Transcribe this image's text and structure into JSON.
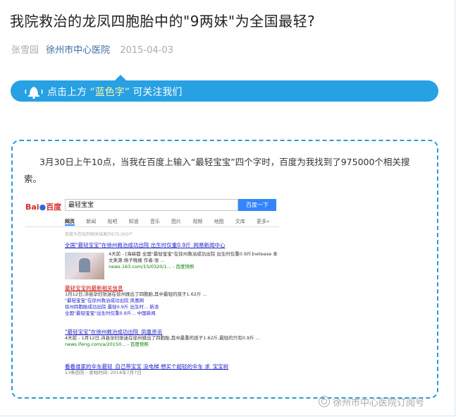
{
  "article": {
    "title": "我院救治的龙凤四胞胎中的\"9两妹\"为全国最轻?",
    "author": "张雪园",
    "account": "徐州市中心医院",
    "date": "2015-04-03"
  },
  "banner": {
    "prefix": "点击上方",
    "highlight": "“蓝色字”",
    "suffix": "可关注我们",
    "color": "#27a0e4"
  },
  "content": {
    "paragraph": "3月30日上午10点，当我在百度上输入“最轻宝宝”四个字时，百度为我找到了975000个相关搜索。",
    "border_color": "#2a9bd6"
  },
  "search_screenshot": {
    "logo": "Bai百度",
    "query": "最轻宝宝",
    "button": "百度一下",
    "tabs": [
      "网页",
      "新闻",
      "贴吧",
      "知道",
      "音乐",
      "图片",
      "视频",
      "地图",
      "文库",
      "更多»"
    ],
    "result_count": "百度为您找到相关结果约975,000个",
    "results": [
      {
        "title": "全国\"最轻宝宝\"在徐州救治成功出院 出生时仅重0.9斤_网易新闻中心",
        "snippet": "4天前 - [海峡都 全国\"最轻宝宝\"在徐州救治成功出院 出生时仅重0.9斤]netease 本文来源:扬子晚报 作者:张 ...",
        "url": "news.163.com/15/0320/1... - 百度快照",
        "related": []
      },
      {
        "title": "最轻宝宝的最新相关信息",
        "snippet": "1月12日,沛县孕妇张迷在徐州娩出了四胞胎,其中最轻的孩子1.62斤 ...",
        "url": "",
        "related": [
          "\"最轻宝宝\"在徐州救治成功出院  凤凰网",
          "徐州四胞胎成功出院 最轻0.9斤 出生时... 新浪",
          "全国\"最轻宝宝\"出生时仅重0.9斤... 中国新闻"
        ]
      },
      {
        "title": "\"最轻宝宝\"在徐州救治成功出院_凤凰资讯",
        "snippet": "4天前 - 1月12日,沛县孕妇张迷在徐州娩出了四胞胎,其中最重的孩子1.62斤,最轻的只有0.9斤 ...",
        "url": "news.ifeng.com/a/20150... - 百度快照",
        "related": []
      },
      {
        "title": "看看谁家的伞车最轻_自己带宝宝 没电梯 想买个超轻的伞车 求_宝宝树",
        "snippet": "13条回答 - 发帖时间: 2014年7月7日",
        "url": "",
        "related": []
      }
    ]
  },
  "watermark": "徐州市中心医院订阅号"
}
